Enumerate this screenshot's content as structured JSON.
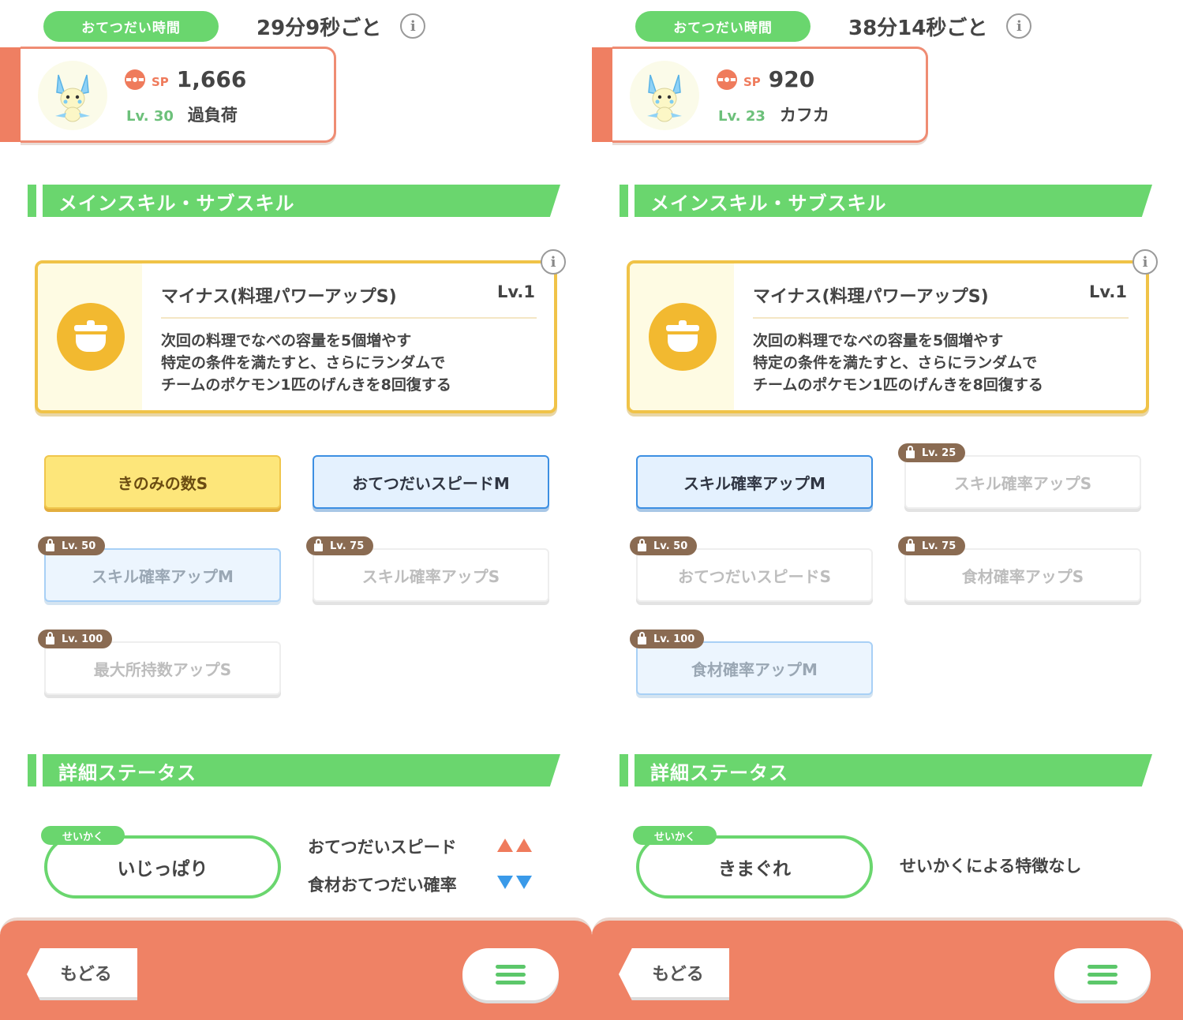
{
  "left": {
    "help_label": "おてつだい時間",
    "help_value": "29分9秒ごと",
    "info_glyph": "i",
    "sp_label": "SP",
    "sp_value": "1,666",
    "level": "Lv. 30",
    "pokemon_name": "過負荷",
    "skill_section_title": "メインスキル・サブスキル",
    "main_skill": {
      "name": "マイナス(料理パワーアップS)",
      "level": "Lv.1",
      "desc": [
        "次回の料理でなべの容量を5個増やす",
        "特定の条件を満たすと、さらにランダムで",
        "チームのポケモン1匹のげんきを8回復する"
      ]
    },
    "subskills": [
      {
        "label": "きのみの数S",
        "lock": ""
      },
      {
        "label": "おてつだいスピードM",
        "lock": ""
      },
      {
        "label": "スキル確率アップM",
        "lock": "Lv. 50"
      },
      {
        "label": "スキル確率アップS",
        "lock": "Lv. 75"
      },
      {
        "label": "最大所持数アップS",
        "lock": "Lv. 100"
      }
    ],
    "status_section_title": "詳細ステータス",
    "nature_tag": "せいかく",
    "nature": "いじっぱり",
    "nature_up": "おてつだいスピード",
    "nature_down": "食材おてつだい確率",
    "back_label": "もどる"
  },
  "right": {
    "help_label": "おてつだい時間",
    "help_value": "38分14秒ごと",
    "info_glyph": "i",
    "sp_label": "SP",
    "sp_value": "920",
    "level": "Lv. 23",
    "pokemon_name": "カフカ",
    "skill_section_title": "メインスキル・サブスキル",
    "main_skill": {
      "name": "マイナス(料理パワーアップS)",
      "level": "Lv.1",
      "desc": [
        "次回の料理でなべの容量を5個増やす",
        "特定の条件を満たすと、さらにランダムで",
        "チームのポケモン1匹のげんきを8回復する"
      ]
    },
    "subskills": [
      {
        "label": "スキル確率アップM",
        "lock": ""
      },
      {
        "label": "スキル確率アップS",
        "lock": "Lv. 25"
      },
      {
        "label": "おてつだいスピードS",
        "lock": "Lv. 50"
      },
      {
        "label": "食材確率アップS",
        "lock": "Lv. 75"
      },
      {
        "label": "食材確率アップM",
        "lock": "Lv. 100"
      }
    ],
    "status_section_title": "詳細ステータス",
    "nature_tag": "せいかく",
    "nature": "きまぐれ",
    "nature_effect": "せいかくによる特徴なし",
    "back_label": "もどる"
  },
  "icons": {
    "avatar": "minun-pokemon-icon",
    "sp": "pokeball-icon",
    "skill": "cooking-pot-icon",
    "lock": "lock-icon",
    "menu": "hamburger-menu-icon",
    "info": "info-icon"
  },
  "colors": {
    "green": "#6ad66e",
    "orange": "#ef8265",
    "gold": "#f0c348",
    "blue": "#3c8fe2",
    "up_arrow": "#ef7b5c",
    "down_arrow": "#3a9ae9"
  }
}
